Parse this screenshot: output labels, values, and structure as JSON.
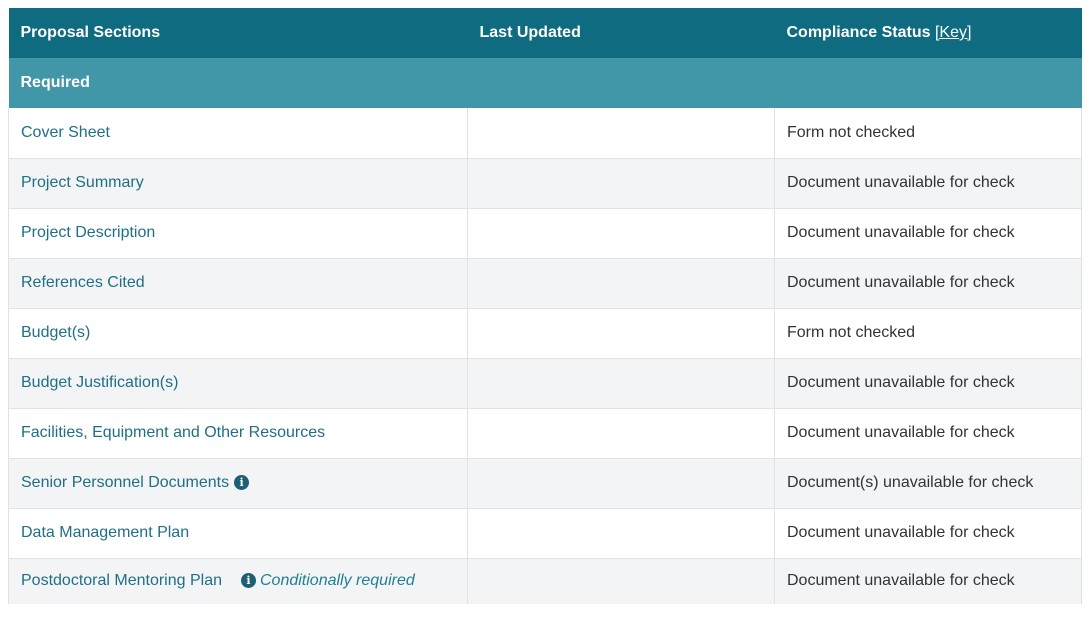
{
  "header": {
    "col_sections": "Proposal Sections",
    "col_updated": "Last Updated",
    "col_status": "Compliance Status",
    "key_link": "[Key]"
  },
  "group": {
    "label": "Required"
  },
  "rows": [
    {
      "section": "Cover Sheet",
      "last_updated": "",
      "status": "Form not checked",
      "icon": "",
      "note": ""
    },
    {
      "section": "Project Summary",
      "last_updated": "",
      "status": "Document unavailable for check",
      "icon": "",
      "note": ""
    },
    {
      "section": "Project Description",
      "last_updated": "",
      "status": "Document unavailable for check",
      "icon": "",
      "note": ""
    },
    {
      "section": "References Cited",
      "last_updated": "",
      "status": "Document unavailable for check",
      "icon": "",
      "note": ""
    },
    {
      "section": "Budget(s)",
      "last_updated": "",
      "status": "Form not checked",
      "icon": "",
      "note": ""
    },
    {
      "section": "Budget Justification(s)",
      "last_updated": "",
      "status": "Document unavailable for check",
      "icon": "",
      "note": ""
    },
    {
      "section": "Facilities, Equipment and Other Resources",
      "last_updated": "",
      "status": "Document unavailable for check",
      "icon": "",
      "note": ""
    },
    {
      "section": "Senior Personnel Documents",
      "last_updated": "",
      "status": "Document(s) unavailable for check",
      "icon": "info-icon",
      "note": ""
    },
    {
      "section": "Data Management Plan",
      "last_updated": "",
      "status": "Document unavailable for check",
      "icon": "",
      "note": ""
    },
    {
      "section": "Postdoctoral Mentoring Plan",
      "last_updated": "",
      "status": "Document unavailable for check",
      "icon": "info-icon",
      "note": "Conditionally required"
    }
  ],
  "colors": {
    "header_bg": "#0f6b80",
    "group_bg": "#4197a8",
    "link": "#1f6f86",
    "row_alt": "#f3f4f6"
  }
}
